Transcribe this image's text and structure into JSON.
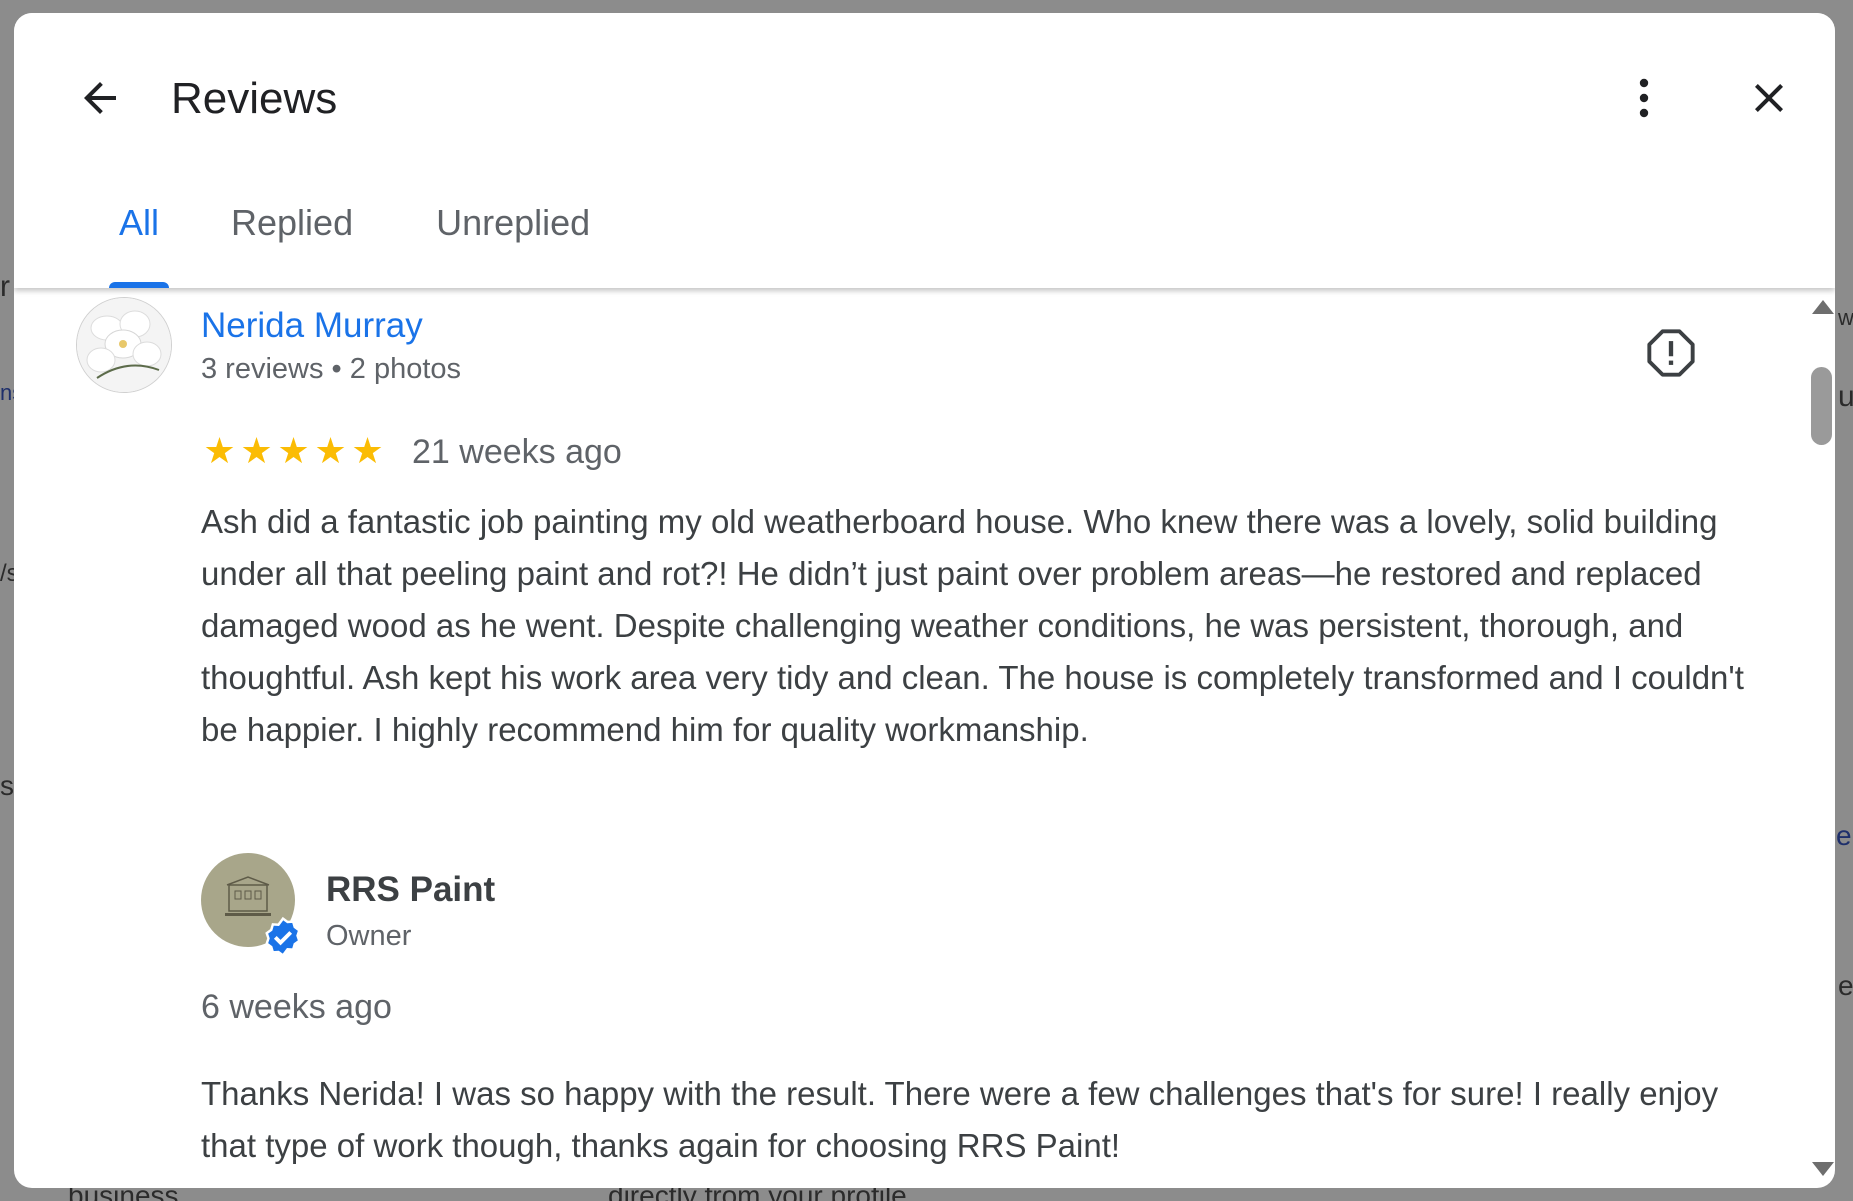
{
  "dialog": {
    "title": "Reviews",
    "back_icon": "arrow-back-icon",
    "more_icon": "more-vert-icon",
    "close_icon": "close-icon"
  },
  "tabs": [
    {
      "label": "All",
      "active": true
    },
    {
      "label": "Replied",
      "active": false
    },
    {
      "label": "Unreplied",
      "active": false
    }
  ],
  "review": {
    "reviewer_name": "Nerida Murray",
    "reviewer_meta": "3 reviews • 2 photos",
    "rating": 5,
    "time": "21 weeks ago",
    "text": "Ash did a fantastic job painting my old weatherboard house. Who knew there was a lovely, solid building under all that peeling paint and rot?! He didn’t just paint over problem areas—he restored and replaced damaged wood as he went. Despite challenging weather conditions, he was persistent, thorough, and thoughtful. Ash kept his work area very tidy and clean. The house is completely transformed and I couldn't be happier. I highly recommend him for quality workmanship.",
    "flag_icon": "report-flag-icon"
  },
  "reply": {
    "owner_name": "RRS Paint",
    "owner_role": "Owner",
    "time": "6 weeks ago",
    "text": "Thanks Nerida! I was so happy with the result. There were a few challenges that's for sure! I really enjoy that type of work though, thanks again for choosing RRS Paint!",
    "verified_icon": "verified-badge-icon"
  },
  "colors": {
    "accent": "#1a73e8",
    "star": "#fbbc04",
    "text": "#3c4043",
    "secondary_text": "#5f6368"
  }
}
